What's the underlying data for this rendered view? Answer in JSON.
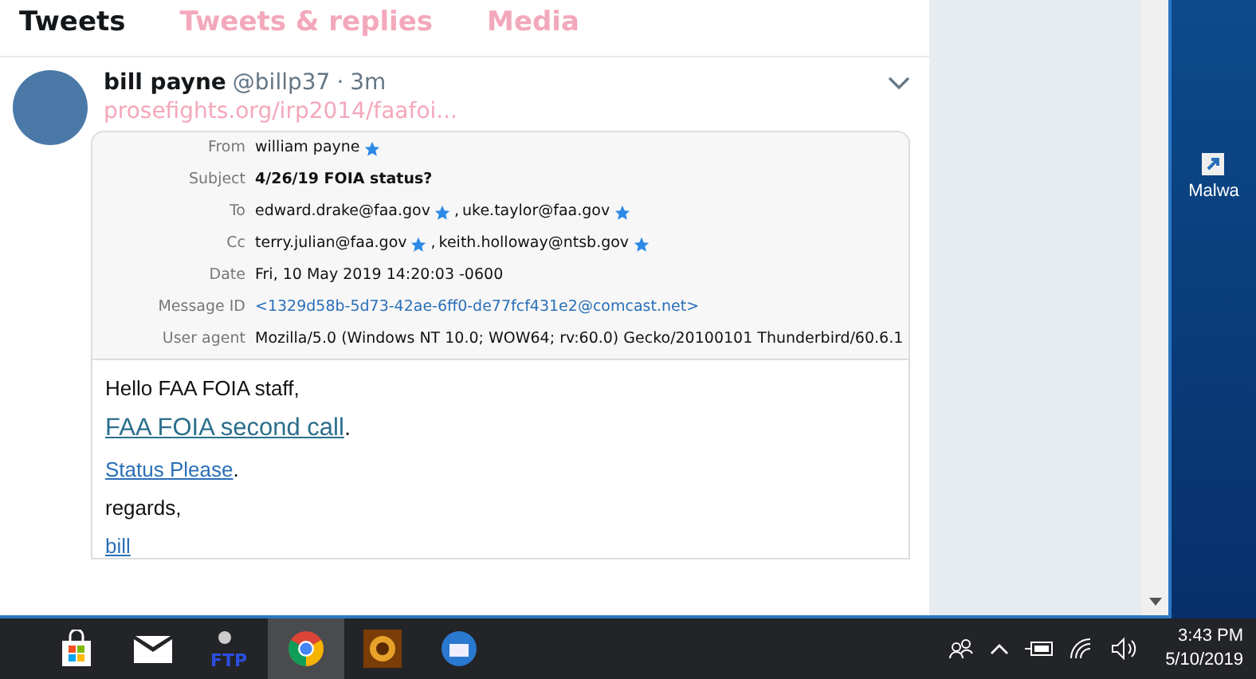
{
  "tabs": [
    {
      "label": "Tweets",
      "selected": true
    },
    {
      "label": "Tweets & replies",
      "selected": false
    },
    {
      "label": "Media",
      "selected": false
    }
  ],
  "tweet": {
    "author": "bill payne",
    "handle": "@billp37",
    "separator": "·",
    "time": "3m",
    "link": "prosefights.org/irp2014/faafoi...",
    "email": {
      "headers": [
        {
          "label": "From",
          "kind": "contacts",
          "contacts": [
            "william payne"
          ]
        },
        {
          "label": "Subject",
          "kind": "bold",
          "value": "4/26/19 FOIA status?"
        },
        {
          "label": "To",
          "kind": "contacts",
          "contacts": [
            "edward.drake@faa.gov",
            "uke.taylor@faa.gov"
          ],
          "separator": ","
        },
        {
          "label": "Cc",
          "kind": "contacts",
          "contacts": [
            "terry.julian@faa.gov",
            "keith.holloway@ntsb.gov"
          ],
          "separator": ","
        },
        {
          "label": "Date",
          "kind": "text",
          "value": "Fri, 10 May 2019 14:20:03 -0600"
        },
        {
          "label": "Message ID",
          "kind": "link",
          "value": "<1329d58b-5d73-42ae-6ff0-de77fcf431e2@comcast.net>"
        },
        {
          "label": "User agent",
          "kind": "text",
          "value": "Mozilla/5.0 (Windows NT 10.0; WOW64; rv:60.0) Gecko/20100101 Thunderbird/60.6.1"
        }
      ],
      "body": [
        {
          "kind": "text",
          "text": "Hello FAA FOIA staff,"
        },
        {
          "kind": "big_link",
          "text": "FAA FOIA second call",
          "after": "."
        },
        {
          "kind": "link",
          "text": "Status Please",
          "after": "."
        },
        {
          "kind": "text",
          "text": "regards,"
        },
        {
          "kind": "link",
          "text": "bill"
        }
      ]
    }
  },
  "desktop": {
    "icon_label": "Malwa"
  },
  "taskbar": {
    "apps": [
      {
        "kind": "store",
        "selected": false
      },
      {
        "kind": "mail",
        "selected": false
      },
      {
        "kind": "ftp",
        "label": "FTP",
        "selected": false
      },
      {
        "kind": "chrome",
        "selected": true
      },
      {
        "kind": "game",
        "selected": false
      },
      {
        "kind": "thunderbird",
        "selected": false
      }
    ],
    "time": "3:43 PM",
    "date": "5/10/2019"
  }
}
